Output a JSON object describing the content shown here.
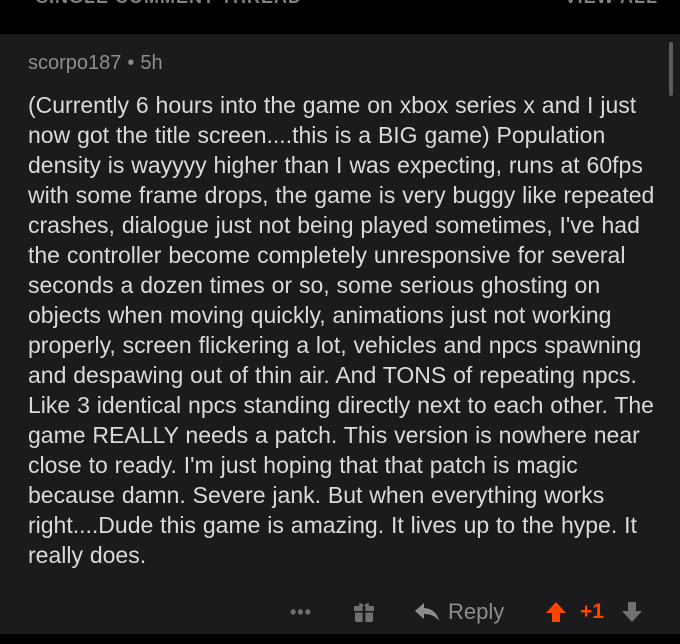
{
  "header": {
    "thread_label": "SINGLE COMMENT THREAD",
    "view_all_label": "VIEW ALL"
  },
  "comment": {
    "author": "scorpo187",
    "separator": "•",
    "age": "5h",
    "body": "(Currently 6 hours into the game on xbox series x and I just now got the title screen....this is a BIG game) Population density is wayyyy higher than I was expecting, runs at 60fps with some frame drops, the game is very buggy like repeated crashes, dialogue just not being played sometimes, I've had the controller become completely unresponsive for several seconds a dozen times or so, some serious ghosting on objects when moving quickly, animations just not working properly, screen flickering a lot, vehicles and npcs spawning and despawing out of thin air. And TONS of repeating npcs. Like 3 identical npcs standing directly next to each other. The game REALLY needs a patch. This version is nowhere near close to ready. I'm just hoping that that patch is magic because damn. Severe jank. But when everything works right....Dude this game is amazing. It lives up to the hype. It really does."
  },
  "actions": {
    "more_label": "•••",
    "reply_label": "Reply",
    "score": "+1",
    "icons": [
      "more-icon",
      "award-icon",
      "reply-arrow-icon",
      "upvote-icon",
      "downvote-icon"
    ]
  },
  "colors": {
    "background": "#000000",
    "card": "#1b1b1d",
    "text": "#d8dadc",
    "meta": "#8c8e91",
    "upvote": "#ff4500"
  }
}
